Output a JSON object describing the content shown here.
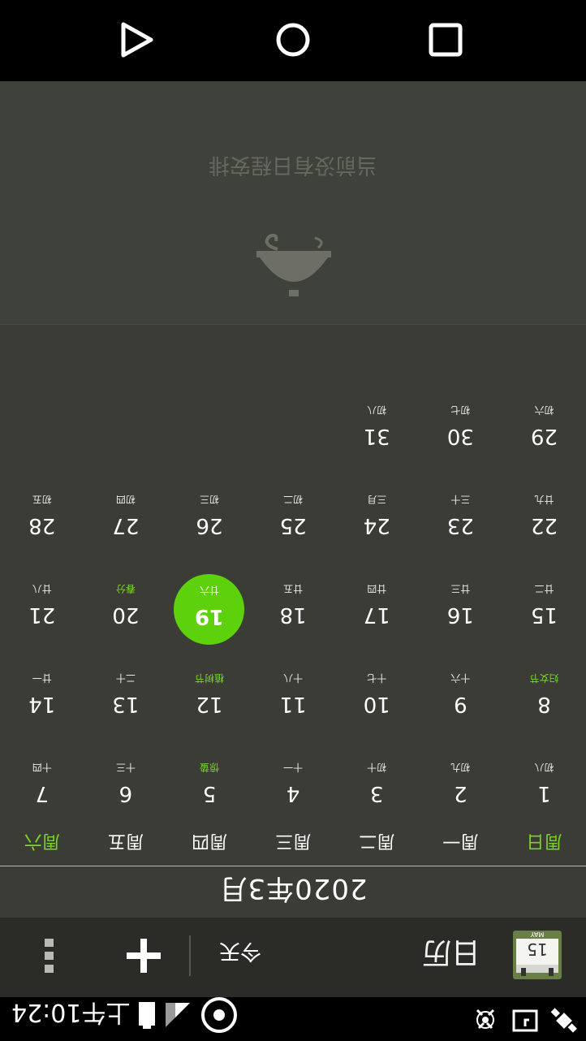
{
  "status_bar": {
    "time": "上午10:24",
    "icons": [
      "satellite-icon",
      "alarm-icon",
      "signal-icon",
      "battery-icon",
      "sync-icon"
    ]
  },
  "app_bar": {
    "title": "日历",
    "logo_text": "MAY",
    "logo_day": "15",
    "today_label": "今天",
    "icons": [
      "calendar-logo-icon",
      "add-icon",
      "more-vert-icon"
    ]
  },
  "calendar": {
    "month_title": "2020年3月",
    "weekdays": [
      "周日",
      "周一",
      "周二",
      "周三",
      "周四",
      "周五",
      "周六"
    ],
    "weeks": [
      [
        {
          "day": "1",
          "lunar": "初八"
        },
        {
          "day": "2",
          "lunar": "初九"
        },
        {
          "day": "3",
          "lunar": "初十"
        },
        {
          "day": "4",
          "lunar": "十一"
        },
        {
          "day": "5",
          "lunar": "惊蛰"
        },
        {
          "day": "6",
          "lunar": "十三"
        },
        {
          "day": "7",
          "lunar": "十四"
        }
      ],
      [
        {
          "day": "8",
          "lunar": "妇女节"
        },
        {
          "day": "9",
          "lunar": "十六"
        },
        {
          "day": "10",
          "lunar": "十七"
        },
        {
          "day": "11",
          "lunar": "十八"
        },
        {
          "day": "12",
          "lunar": "植树节"
        },
        {
          "day": "13",
          "lunar": "二十"
        },
        {
          "day": "14",
          "lunar": "廿一"
        }
      ],
      [
        {
          "day": "15",
          "lunar": "廿二"
        },
        {
          "day": "16",
          "lunar": "廿三"
        },
        {
          "day": "17",
          "lunar": "廿四"
        },
        {
          "day": "18",
          "lunar": "廿五"
        },
        {
          "day": "19",
          "lunar": "廿六"
        },
        {
          "day": "20",
          "lunar": "春分"
        },
        {
          "day": "21",
          "lunar": "廿八"
        }
      ],
      [
        {
          "day": "22",
          "lunar": "廿九"
        },
        {
          "day": "23",
          "lunar": "三十"
        },
        {
          "day": "24",
          "lunar": "三月"
        },
        {
          "day": "25",
          "lunar": "初二"
        },
        {
          "day": "26",
          "lunar": "初三"
        },
        {
          "day": "27",
          "lunar": "初四"
        },
        {
          "day": "28",
          "lunar": "初五"
        }
      ],
      [
        {
          "day": "29",
          "lunar": "初六"
        },
        {
          "day": "30",
          "lunar": "初七"
        },
        {
          "day": "31",
          "lunar": "初八"
        },
        {
          "day": "",
          "lunar": ""
        },
        {
          "day": "",
          "lunar": ""
        },
        {
          "day": "",
          "lunar": ""
        },
        {
          "day": "",
          "lunar": ""
        }
      ]
    ],
    "today_day": "19",
    "highlight_days": [
      "5",
      "8",
      "12",
      "20"
    ],
    "accent_color": "#5ed10d"
  },
  "empty_state": {
    "text": "当前没有日程安排",
    "icon": "bell-icon"
  },
  "nav_bar": {
    "icons": [
      "back-icon",
      "home-icon",
      "recents-icon"
    ]
  }
}
